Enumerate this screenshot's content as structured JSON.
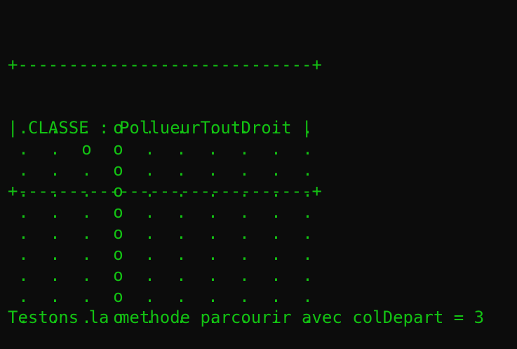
{
  "terminal": {
    "header_top": "+-----------------------------+",
    "header_title": "| CLASSE : PollueurToutDroit |",
    "header_bottom": "+-----------------------------+",
    "blank": "",
    "test_line": "Testons la methode parcourir avec colDepart = 3"
  },
  "grid": {
    "rows": [
      [
        ".",
        ".",
        ".",
        "o",
        ".",
        ".",
        ".",
        ".",
        ".",
        "."
      ],
      [
        ".",
        ".",
        "o",
        "o",
        ".",
        ".",
        ".",
        ".",
        ".",
        "."
      ],
      [
        ".",
        ".",
        ".",
        "o",
        ".",
        ".",
        ".",
        ".",
        ".",
        "."
      ],
      [
        ".",
        ".",
        ".",
        "o",
        ".",
        ".",
        ".",
        ".",
        ".",
        "."
      ],
      [
        ".",
        ".",
        ".",
        "o",
        ".",
        ".",
        ".",
        ".",
        ".",
        "."
      ],
      [
        ".",
        ".",
        ".",
        "o",
        ".",
        ".",
        ".",
        ".",
        ".",
        "."
      ],
      [
        ".",
        ".",
        ".",
        "o",
        ".",
        ".",
        ".",
        ".",
        ".",
        "."
      ],
      [
        ".",
        ".",
        ".",
        "o",
        ".",
        ".",
        ".",
        ".",
        ".",
        "."
      ],
      [
        ".",
        ".",
        ".",
        "o",
        ".",
        ".",
        ".",
        ".",
        ".",
        "."
      ],
      [
        ".",
        ".",
        ".",
        "o",
        ".",
        ".",
        ".",
        ".",
        ".",
        "."
      ]
    ]
  },
  "colors": {
    "background": "#0c0c0c",
    "text": "#13c313"
  }
}
